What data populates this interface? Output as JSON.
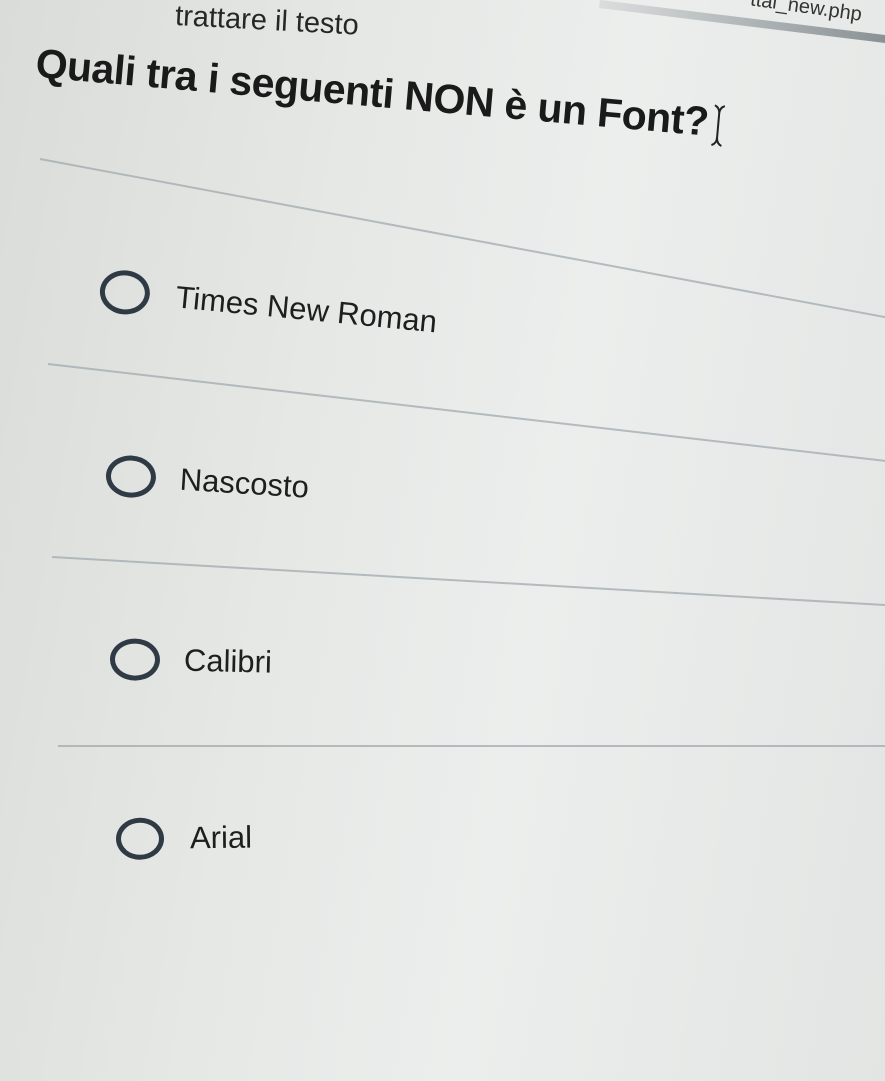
{
  "browser": {
    "url_fragment": "ttal_new.php"
  },
  "page": {
    "header_hint": "trattare il testo"
  },
  "question": {
    "text": "Quali tra i seguenti NON è un Font?"
  },
  "options": [
    {
      "label": "Times New Roman",
      "selected": false
    },
    {
      "label": "Nascosto",
      "selected": false
    },
    {
      "label": "Calibri",
      "selected": false
    },
    {
      "label": "Arial",
      "selected": false
    }
  ],
  "icons": {
    "radio": "radio-unchecked-icon",
    "cursor": "text-cursor-icon"
  },
  "colors": {
    "radio_border": "#2f3a44",
    "divider": "#a0aaaf"
  }
}
